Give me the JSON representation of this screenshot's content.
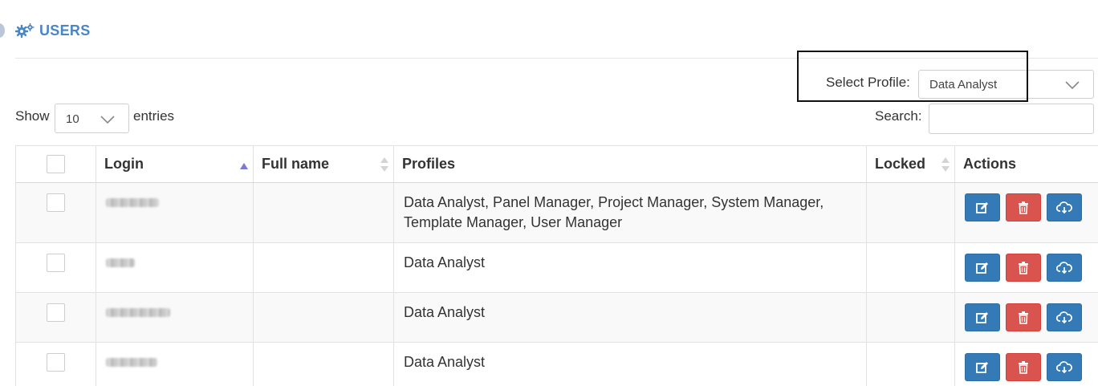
{
  "header": {
    "title": "USERS",
    "title_icon": "cogs-icon",
    "accent_color": "#4a86c5"
  },
  "profile_filter": {
    "label": "Select Profile:",
    "selected": "Data Analyst"
  },
  "length_menu": {
    "show_label": "Show",
    "selected": "10",
    "entries_label": "entries"
  },
  "search": {
    "label": "Search:",
    "value": "",
    "placeholder": ""
  },
  "table": {
    "columns": [
      {
        "label": "",
        "type": "checkbox"
      },
      {
        "label": "Login",
        "sort": "ascending"
      },
      {
        "label": "Full name",
        "sort": "none"
      },
      {
        "label": "Profiles"
      },
      {
        "label": "Locked",
        "sort": "none"
      },
      {
        "label": "Actions"
      }
    ],
    "rows": [
      {
        "login_redacted": true,
        "full_name": "",
        "profiles": "Data Analyst, Panel Manager, Project Manager, System Manager, Template Manager, User Manager",
        "locked": ""
      },
      {
        "login_redacted": true,
        "full_name": "",
        "profiles": "Data Analyst",
        "locked": ""
      },
      {
        "login_redacted": true,
        "full_name": "",
        "profiles": "Data Analyst",
        "locked": ""
      },
      {
        "login_redacted": true,
        "full_name": "",
        "profiles": "Data Analyst",
        "locked": ""
      }
    ],
    "action_icons": [
      "edit-icon",
      "trash-icon",
      "cloud-download-icon"
    ],
    "action_colors": {
      "edit": "#337ab7",
      "delete": "#d9534f",
      "download": "#337ab7"
    }
  }
}
